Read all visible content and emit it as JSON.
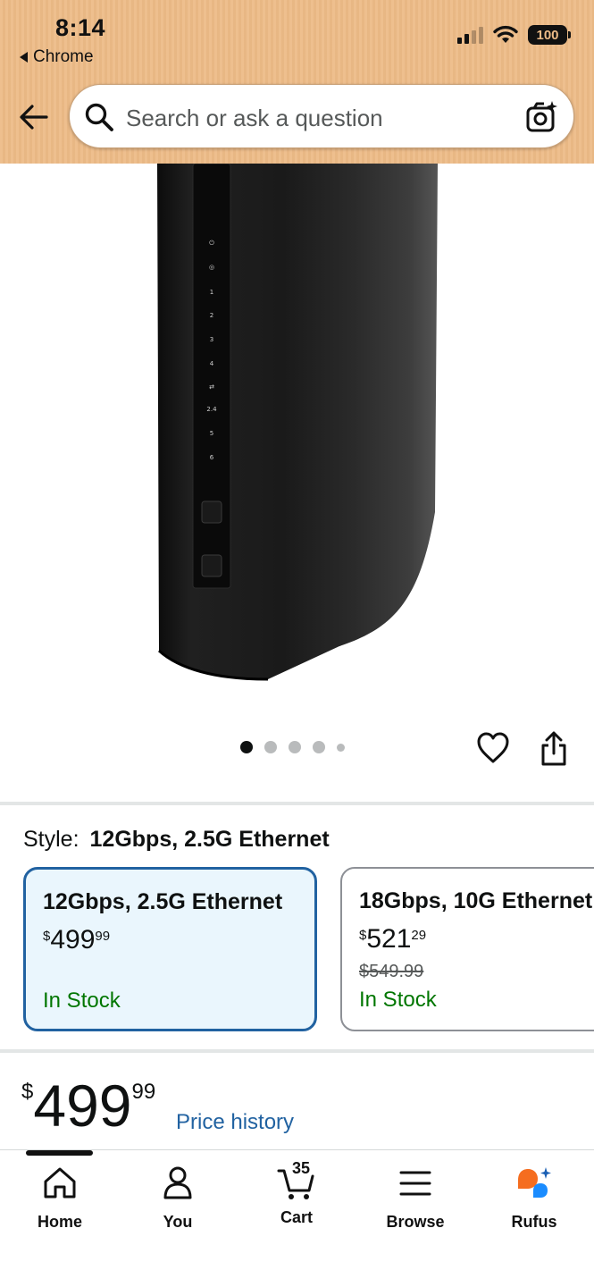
{
  "status_bar": {
    "time": "8:14",
    "back_app": "Chrome",
    "battery": "100"
  },
  "search": {
    "placeholder": "Search or ask a question"
  },
  "gallery": {
    "total_images": 5,
    "active_index": 0
  },
  "style": {
    "label": "Style:",
    "selected": "12Gbps, 2.5G Ethernet",
    "options": [
      {
        "title": "12Gbps, 2.5G Ethernet",
        "price_symbol": "$",
        "price_whole": "499",
        "price_cents": "99",
        "was_price": "",
        "stock": "In Stock"
      },
      {
        "title": "18Gbps, 10G Ethernet",
        "price_symbol": "$",
        "price_whole": "521",
        "price_cents": "29",
        "was_price": "$549.99",
        "stock": "In Stock"
      }
    ]
  },
  "price": {
    "symbol": "$",
    "whole": "499",
    "cents": "99",
    "history_link": "Price history"
  },
  "tabs": [
    {
      "label": "Home",
      "icon": "home-icon"
    },
    {
      "label": "You",
      "icon": "person-icon"
    },
    {
      "label": "Cart",
      "icon": "cart-icon",
      "count": "35"
    },
    {
      "label": "Browse",
      "icon": "menu-icon"
    },
    {
      "label": "Rufus",
      "icon": "rufus-icon"
    }
  ],
  "colors": {
    "header_bg": "#edbb87",
    "link": "#2162a1",
    "in_stock": "#007600",
    "selected_card_bg": "#eaf6fd",
    "rufus_orange": "#f56d1f",
    "rufus_blue": "#1a8cff"
  }
}
